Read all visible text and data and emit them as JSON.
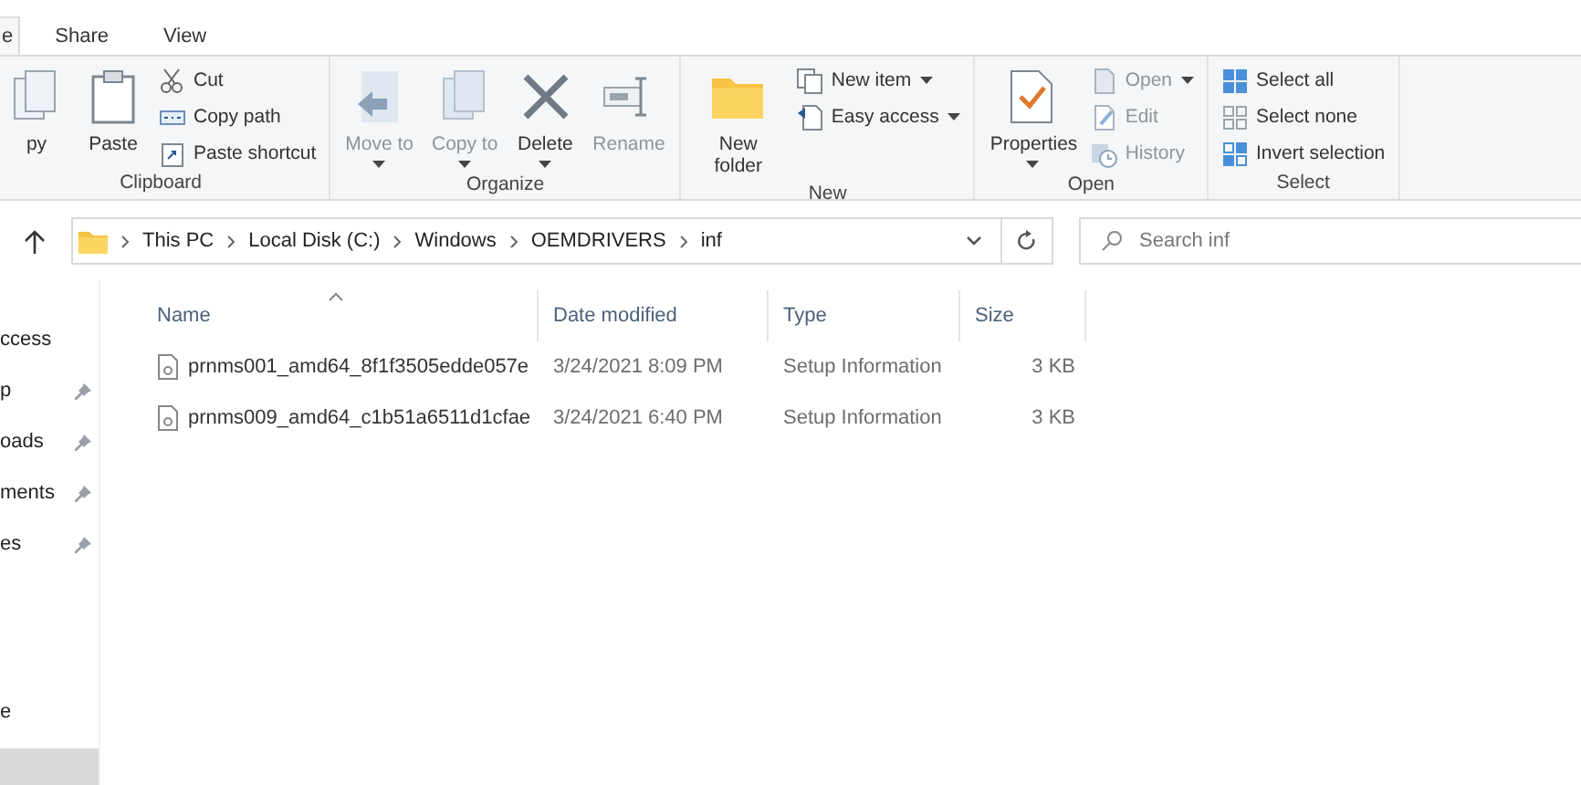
{
  "tabs": [
    {
      "label": "e",
      "selected": true
    },
    {
      "label": "Share",
      "selected": false
    },
    {
      "label": "View",
      "selected": false
    }
  ],
  "ribbon": {
    "groups": [
      {
        "label": "Clipboard",
        "items": [
          {
            "kind": "large",
            "label": "py",
            "disabled": false,
            "dropdown": false
          },
          {
            "kind": "large",
            "label": "Paste",
            "disabled": false,
            "dropdown": false
          },
          {
            "kind": "small",
            "label": "Cut",
            "disabled": false,
            "dropdown": false
          },
          {
            "kind": "small",
            "label": "Copy path",
            "disabled": false,
            "dropdown": false
          },
          {
            "kind": "small",
            "label": "Paste shortcut",
            "disabled": false,
            "dropdown": false
          }
        ]
      },
      {
        "label": "Organize",
        "items": [
          {
            "kind": "large",
            "label": "Move to",
            "disabled": true,
            "dropdown": true
          },
          {
            "kind": "large",
            "label": "Copy to",
            "disabled": true,
            "dropdown": true
          },
          {
            "kind": "large",
            "label": "Delete",
            "disabled": false,
            "dropdown": true
          },
          {
            "kind": "large",
            "label": "Rename",
            "disabled": true,
            "dropdown": false
          }
        ]
      },
      {
        "label": "New",
        "items": [
          {
            "kind": "large",
            "label": "New folder",
            "disabled": false,
            "dropdown": false
          },
          {
            "kind": "small",
            "label": "New item",
            "disabled": false,
            "dropdown": true
          },
          {
            "kind": "small",
            "label": "Easy access",
            "disabled": false,
            "dropdown": true
          }
        ]
      },
      {
        "label": "Open",
        "items": [
          {
            "kind": "large",
            "label": "Properties",
            "disabled": false,
            "dropdown": true
          },
          {
            "kind": "small",
            "label": "Open",
            "disabled": true,
            "dropdown": true
          },
          {
            "kind": "small",
            "label": "Edit",
            "disabled": true,
            "dropdown": false
          },
          {
            "kind": "small",
            "label": "History",
            "disabled": true,
            "dropdown": false
          }
        ]
      },
      {
        "label": "Select",
        "items": [
          {
            "kind": "small",
            "label": "Select all",
            "disabled": false,
            "dropdown": false
          },
          {
            "kind": "small",
            "label": "Select none",
            "disabled": false,
            "dropdown": false
          },
          {
            "kind": "small",
            "label": "Invert selection",
            "disabled": false,
            "dropdown": false
          }
        ]
      }
    ]
  },
  "address": {
    "breadcrumbs": [
      "This PC",
      "Local Disk (C:)",
      "Windows",
      "OEMDRIVERS",
      "inf"
    ]
  },
  "search": {
    "placeholder": "Search inf"
  },
  "sidebar": {
    "sections": [
      {
        "items": [
          {
            "label": "ccess",
            "pinned": false,
            "selected": false
          },
          {
            "label": "p",
            "pinned": true,
            "selected": false
          },
          {
            "label": "oads",
            "pinned": true,
            "selected": false
          },
          {
            "label": "ments",
            "pinned": true,
            "selected": false
          },
          {
            "label": "es",
            "pinned": true,
            "selected": false
          }
        ]
      },
      {
        "items": [
          {
            "label": "e",
            "pinned": false,
            "selected": false
          },
          {
            "pinned": false,
            "selected": true
          }
        ]
      }
    ]
  },
  "table": {
    "columns": [
      {
        "label": "Name",
        "sorted": true
      },
      {
        "label": "Date modified",
        "sorted": false
      },
      {
        "label": "Type",
        "sorted": false
      },
      {
        "label": "Size",
        "sorted": false
      }
    ],
    "rows": [
      {
        "name": "prnms001_amd64_8f1f3505edde057e",
        "date": "3/24/2021 8:09 PM",
        "type": "Setup Information",
        "size": "3 KB"
      },
      {
        "name": "prnms009_amd64_c1b51a6511d1cfae",
        "date": "3/24/2021 6:40 PM",
        "type": "Setup Information",
        "size": "3 KB"
      }
    ]
  }
}
